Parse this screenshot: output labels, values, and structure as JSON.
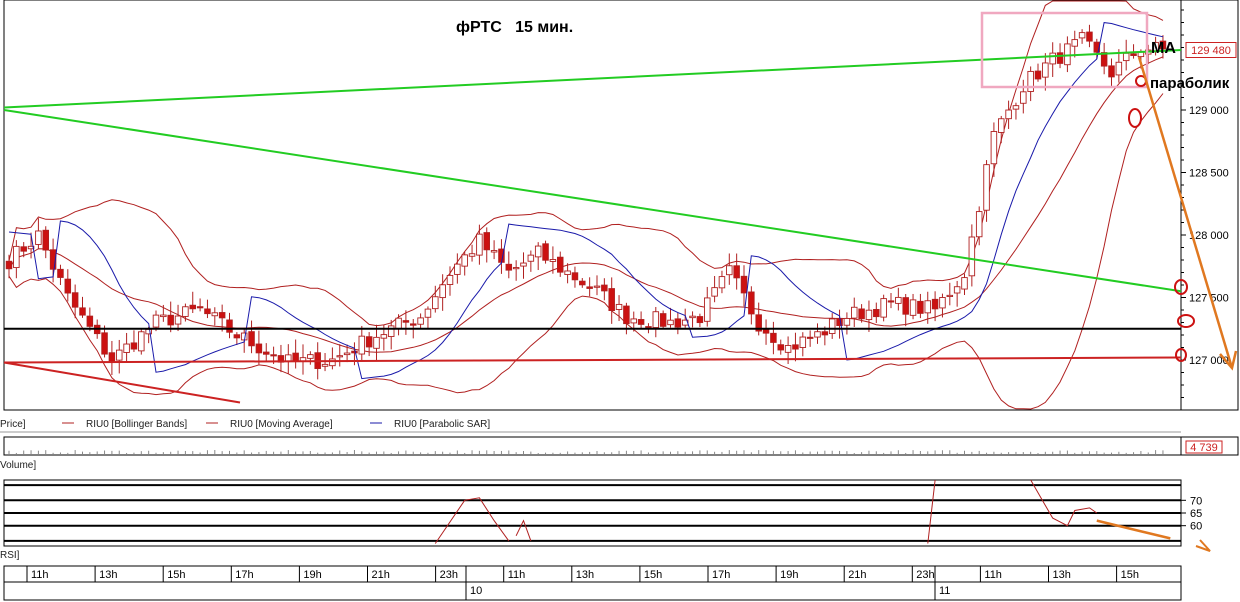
{
  "chart_data": [
    {
      "type": "candlestick",
      "title": "фРТС   15 мин.",
      "ylim": [
        126600,
        129880
      ],
      "yticks": [
        127000,
        127500,
        128000,
        128500,
        129000
      ],
      "ytick_labels": [
        "127 000",
        "127 500",
        "128 000",
        "128 500",
        "129 000"
      ],
      "last_price_label": "129 480",
      "last_price": 129480,
      "legend": [
        "Price]",
        "RIU0 [Bollinger Bands]",
        "RIU0 [Moving Average]",
        "RIU0 [Parabolic SAR]"
      ],
      "annotations": [
        {
          "text": "MA",
          "price": 129470
        },
        {
          "text": "параболик",
          "price": 129190
        }
      ],
      "horizontal_levels": [
        127250
      ],
      "trend_lines": [
        {
          "name": "upper-green",
          "color": "#22cc22",
          "from": [
            0,
            129020
          ],
          "to": [
            1,
            129480
          ]
        },
        {
          "name": "lower-green",
          "color": "#22cc22",
          "from": [
            0,
            129000
          ],
          "to": [
            1,
            127550
          ]
        },
        {
          "name": "red-support",
          "color": "#cc2222",
          "from": [
            0,
            126980
          ],
          "to": [
            1,
            127020
          ]
        }
      ],
      "series": [
        {
          "name": "Price",
          "type": "candles"
        },
        {
          "name": "RIU0 [Bollinger Bands]",
          "type": "band",
          "color": "#b02020"
        },
        {
          "name": "RIU0 [Moving Average]",
          "type": "line",
          "color": "#b02020"
        },
        {
          "name": "RIU0 [Parabolic SAR]",
          "type": "line",
          "color": "#1a1aaa"
        }
      ],
      "anchors": [
        [
          0,
          127800
        ],
        [
          4,
          128000
        ],
        [
          8,
          127500
        ],
        [
          14,
          127000
        ],
        [
          20,
          127300
        ],
        [
          26,
          127400
        ],
        [
          31,
          127200
        ],
        [
          38,
          126980
        ],
        [
          44,
          127000
        ],
        [
          50,
          127200
        ],
        [
          56,
          127350
        ],
        [
          60,
          127700
        ],
        [
          64,
          127950
        ],
        [
          68,
          127700
        ],
        [
          72,
          127850
        ],
        [
          76,
          127700
        ],
        [
          80,
          127550
        ],
        [
          84,
          127350
        ],
        [
          90,
          127300
        ],
        [
          94,
          127350
        ],
        [
          98,
          127700
        ],
        [
          102,
          127300
        ],
        [
          106,
          127100
        ],
        [
          110,
          127200
        ],
        [
          114,
          127350
        ],
        [
          120,
          127450
        ],
        [
          126,
          127400
        ],
        [
          130,
          127700
        ],
        [
          134,
          128800
        ],
        [
          138,
          129200
        ],
        [
          142,
          129400
        ],
        [
          146,
          129550
        ],
        [
          150,
          129300
        ],
        [
          154,
          129500
        ],
        [
          157,
          129480
        ]
      ],
      "xticks": [
        "11h",
        "13h",
        "15h",
        "17h",
        "19h",
        "21h",
        "23h",
        "11h",
        "13h",
        "15h",
        "17h",
        "19h",
        "21h",
        "23h",
        "11h",
        "13h",
        "15h"
      ],
      "days": [
        "10",
        "11"
      ]
    },
    {
      "type": "bar",
      "name": "Volume",
      "panel_label": "Volume]",
      "last_value_label": "4 739"
    },
    {
      "type": "line",
      "name": "RSI",
      "panel_label": "RSI]",
      "levels": [
        70,
        65,
        60
      ],
      "ylim": [
        52,
        78
      ],
      "series": [
        {
          "name": "RSI",
          "color": "#b02020",
          "segments": [
            [
              [
                58,
                53
              ],
              [
                62,
                70
              ],
              [
                64,
                71
              ],
              [
                66,
                62
              ],
              [
                68,
                54
              ]
            ],
            [
              [
                69,
                56
              ],
              [
                70,
                62
              ],
              [
                71,
                54
              ]
            ],
            [
              [
                125,
                53
              ],
              [
                126,
                78
              ]
            ],
            [
              [
                139,
                78
              ],
              [
                141,
                68
              ],
              [
                142,
                63
              ],
              [
                144,
                60
              ],
              [
                145,
                66
              ],
              [
                147,
                67
              ],
              [
                148,
                65
              ]
            ]
          ]
        },
        {
          "name": "RSI forecast",
          "color": "#e07820",
          "segments": [
            [
              [
                148,
                62
              ],
              [
                158,
                55
              ]
            ]
          ]
        }
      ]
    }
  ]
}
